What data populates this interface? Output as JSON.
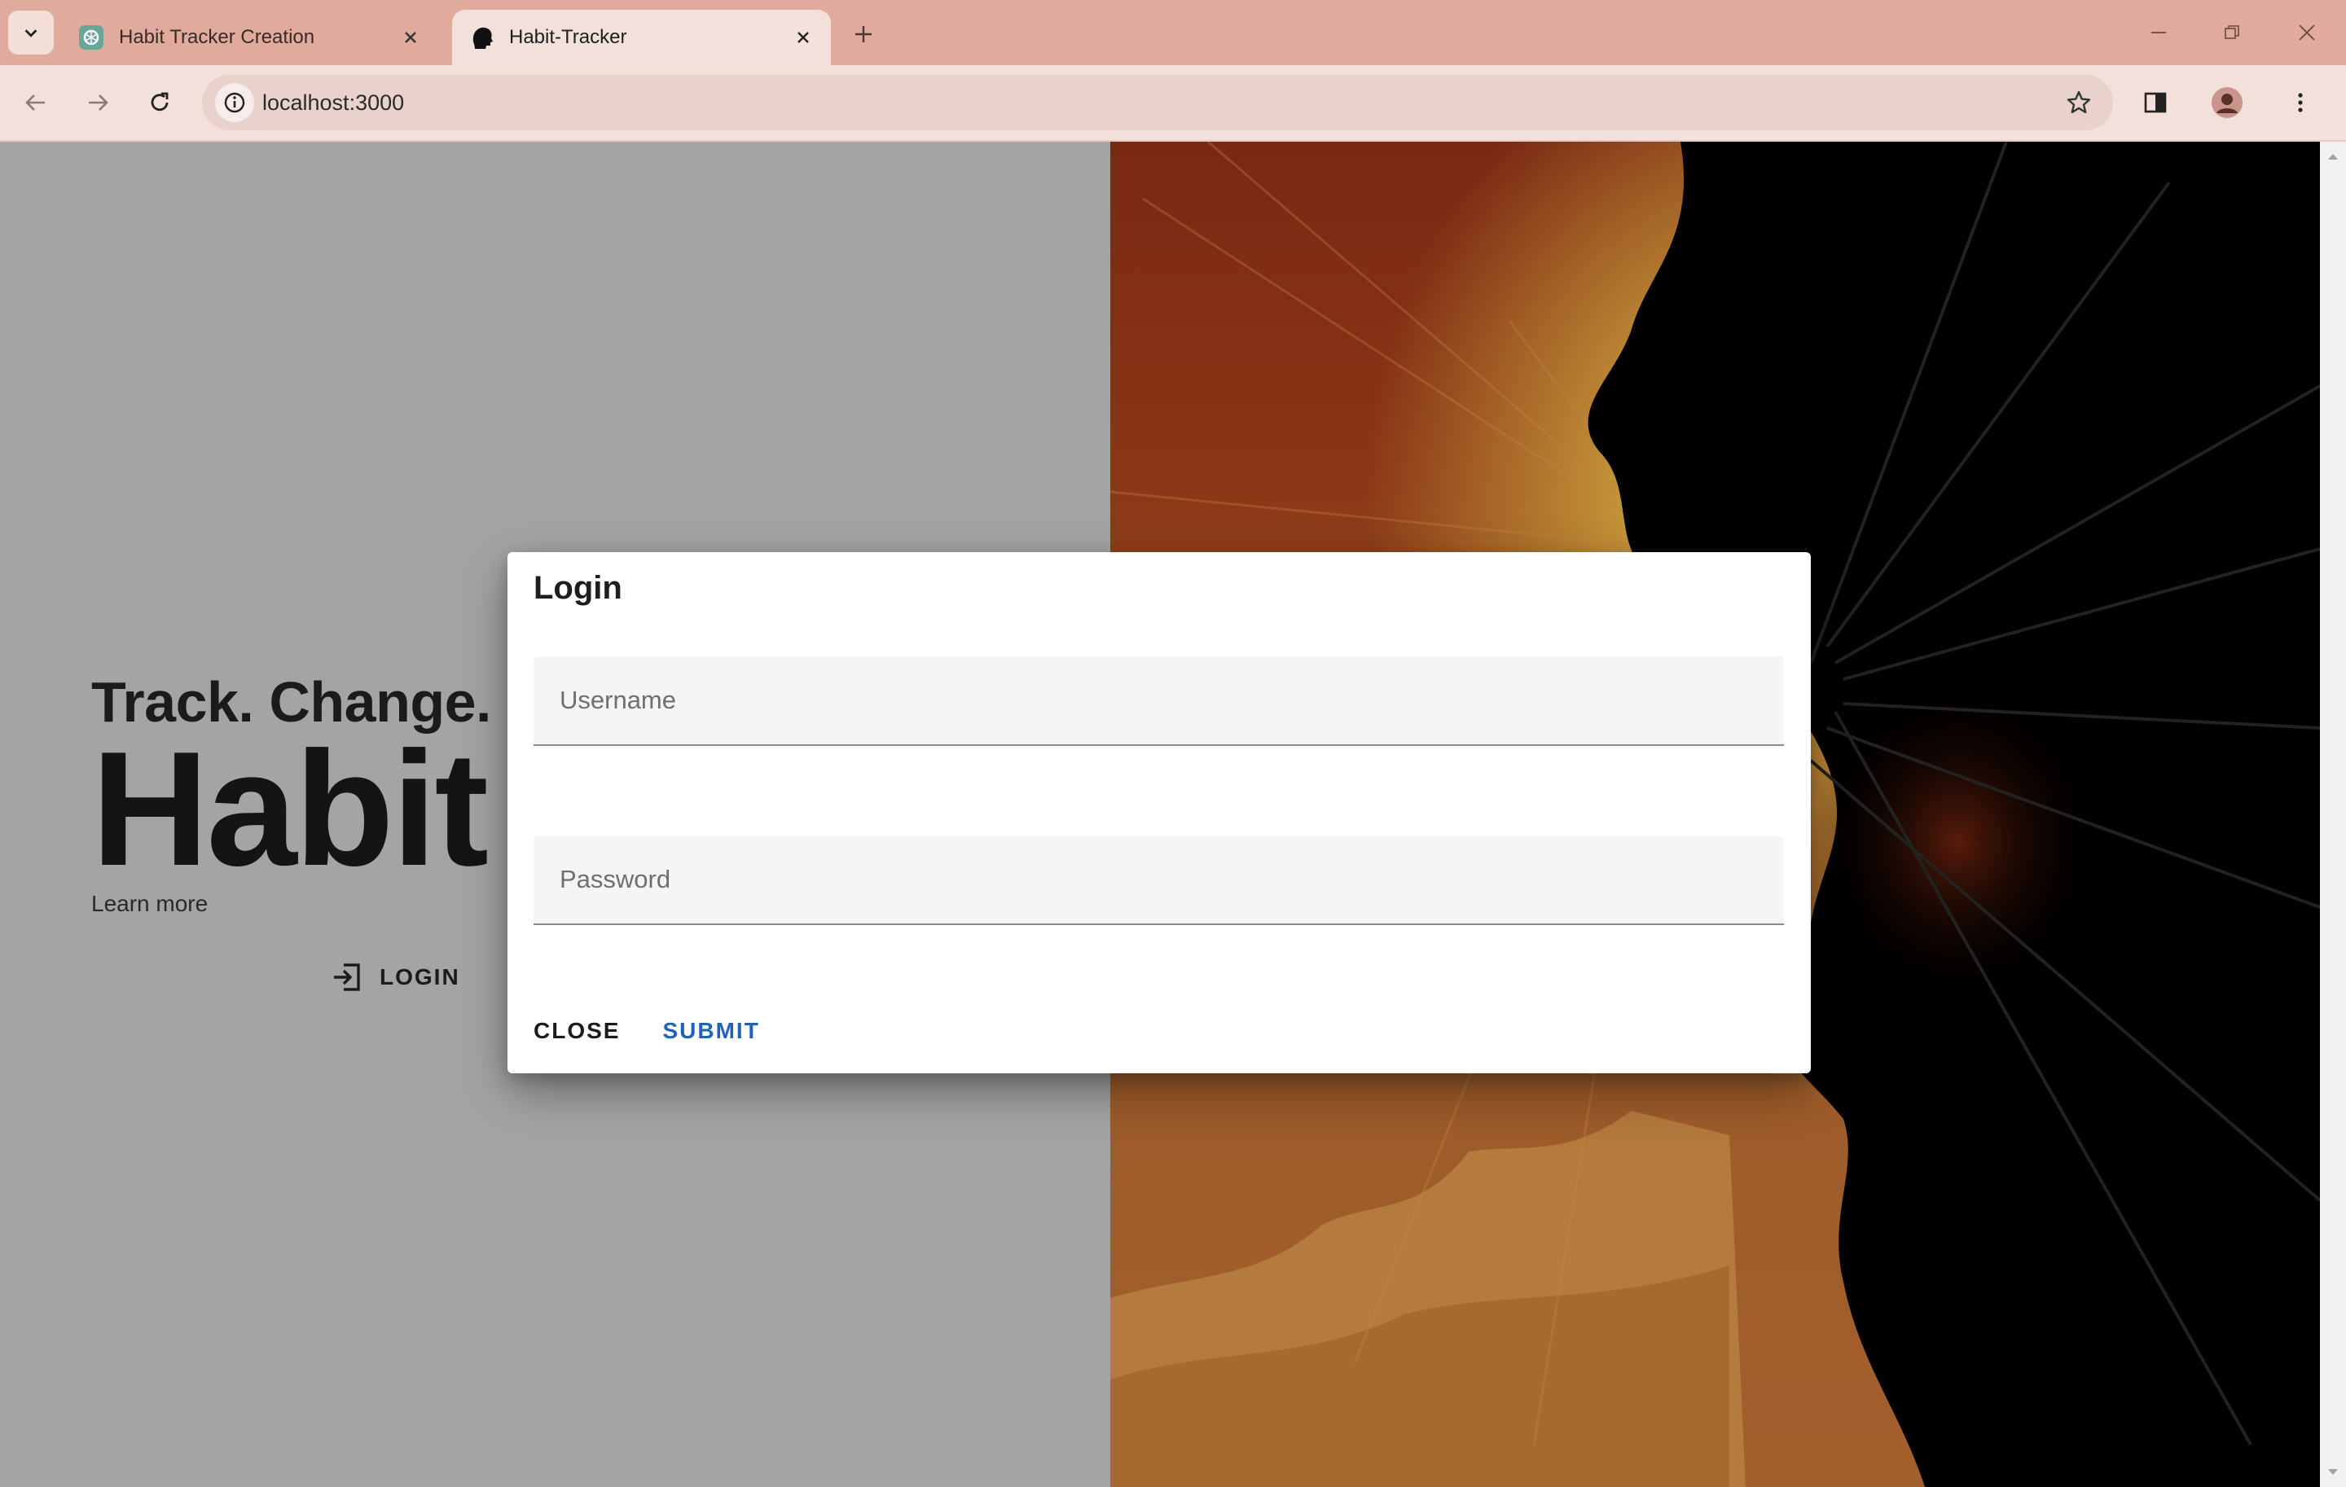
{
  "browser": {
    "tabs": [
      {
        "title": "Habit Tracker Creation",
        "active": false
      },
      {
        "title": "Habit-Tracker",
        "active": true
      }
    ],
    "address": "localhost:3000"
  },
  "hero": {
    "tagline": "Track. Change. G",
    "title": "Habit T",
    "learn_more": "Learn more",
    "login_label": "LOGIN"
  },
  "dialog": {
    "title": "Login",
    "username_placeholder": "Username",
    "password_placeholder": "Password",
    "close_label": "CLOSE",
    "submit_label": "SUBMIT"
  },
  "colors": {
    "tabstrip": "#e0aa9c",
    "toolbar": "#f3e0da",
    "page_background": "#a4a4a4",
    "submit_accent": "#1d63b8"
  }
}
